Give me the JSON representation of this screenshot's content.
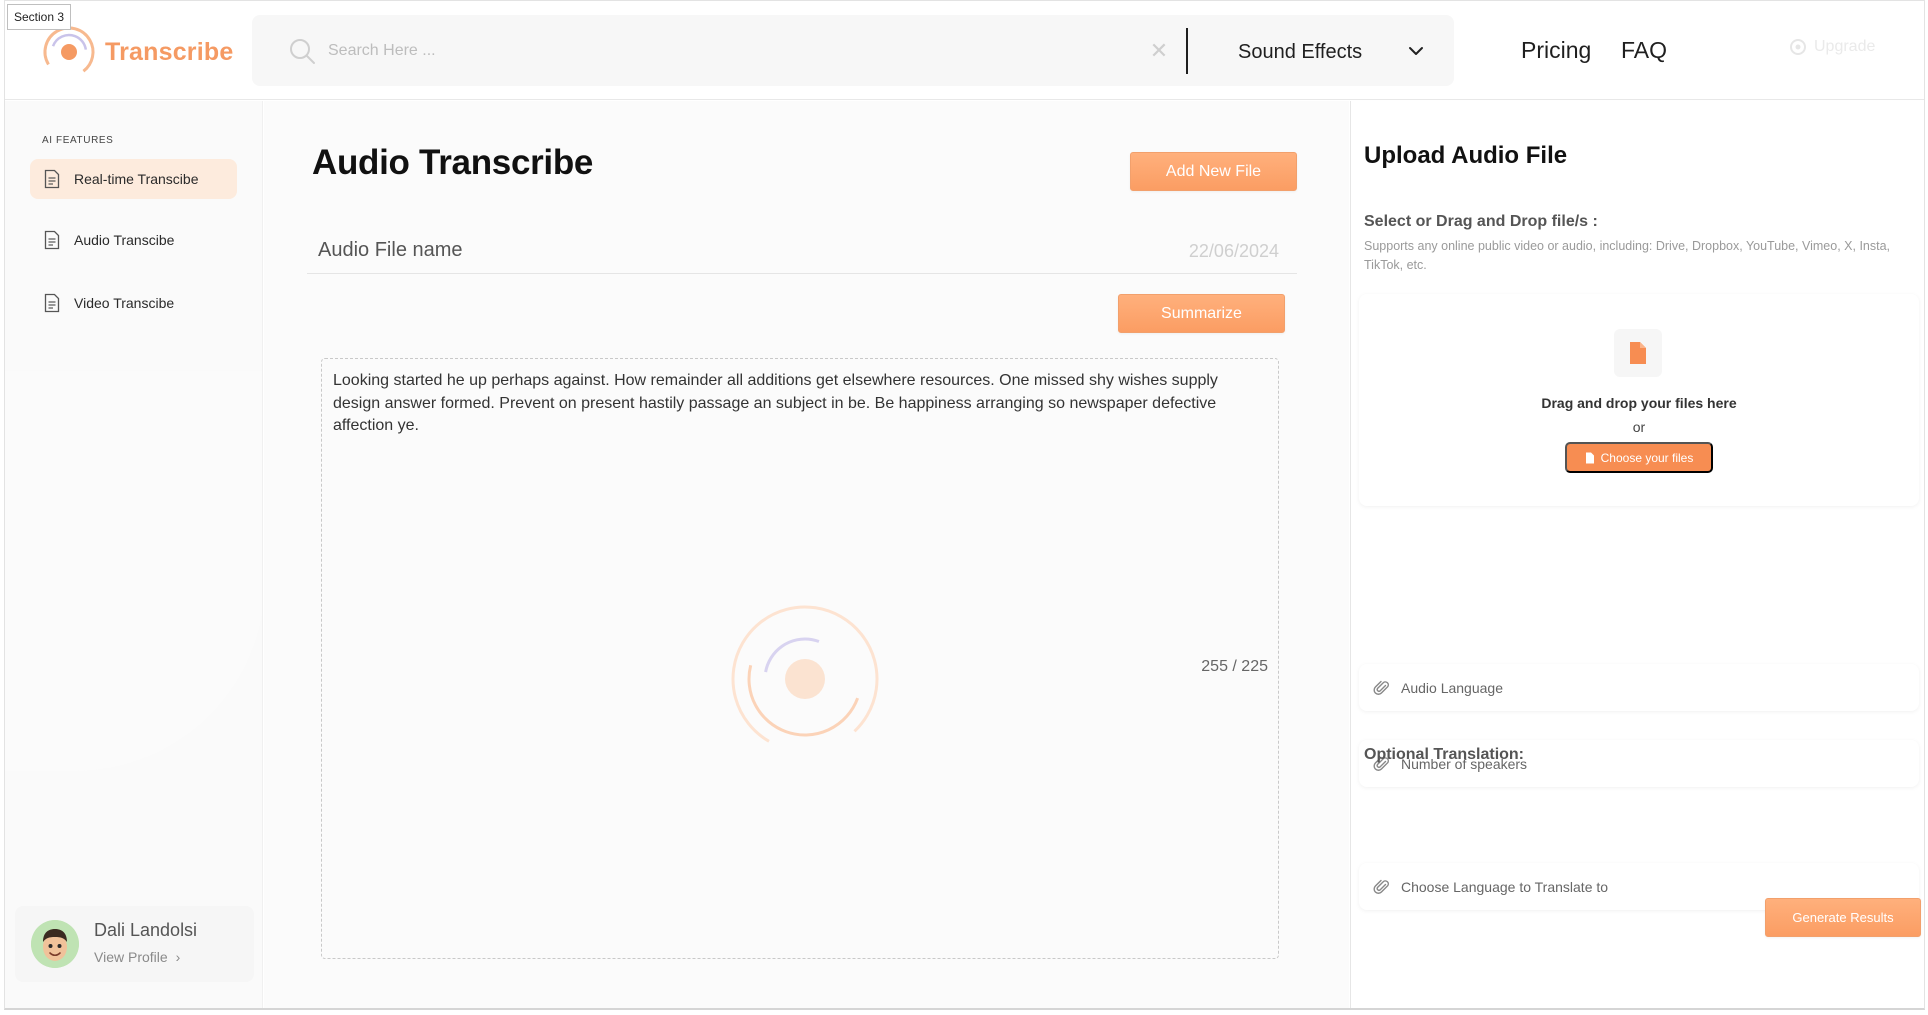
{
  "section_tag": "Section 3",
  "brand": {
    "name": "Transcribe",
    "accent": "#f59a63"
  },
  "header": {
    "search_placeholder": "Search Here ...",
    "category": "Sound Effects",
    "nav": {
      "pricing": "Pricing",
      "faq": "FAQ"
    },
    "upgrade": "Upgrade"
  },
  "sidebar": {
    "heading": "AI FEATURES",
    "items": [
      {
        "label": "Real-time Transcibe",
        "active": true
      },
      {
        "label": "Audio Transcibe",
        "active": false
      },
      {
        "label": "Video Transcibe",
        "active": false
      }
    ],
    "profile": {
      "name": "Dali Landolsi",
      "link": "View Profile"
    }
  },
  "main": {
    "title": "Audio Transcribe",
    "add_button": "Add New File",
    "file_name": "Audio File name",
    "file_date": "22/06/2024",
    "summarize_button": "Summarize",
    "transcript": "Looking started he up perhaps against. How remainder all additions get elsewhere resources. One missed shy wishes supply design answer formed. Prevent on present hastily passage an subject in be. Be happiness arranging so newspaper defective affection ye.",
    "counter": "255 / 225"
  },
  "upload": {
    "title": "Upload Audio File",
    "subtitle": "Select or Drag and Drop file/s :",
    "note": "Supports any online public video or audio, including: Drive, Dropbox, YouTube, Vimeo, X, Insta, TikTok, etc.",
    "drop_title": "Drag and drop your files here",
    "or": "or",
    "choose_button": "Choose your files",
    "audio_language": "Audio Language",
    "speakers": "Number of speakers",
    "optional_title": "Optional Translation:",
    "translate_to": "Choose Language to Translate to",
    "generate_button": "Generate Results"
  }
}
